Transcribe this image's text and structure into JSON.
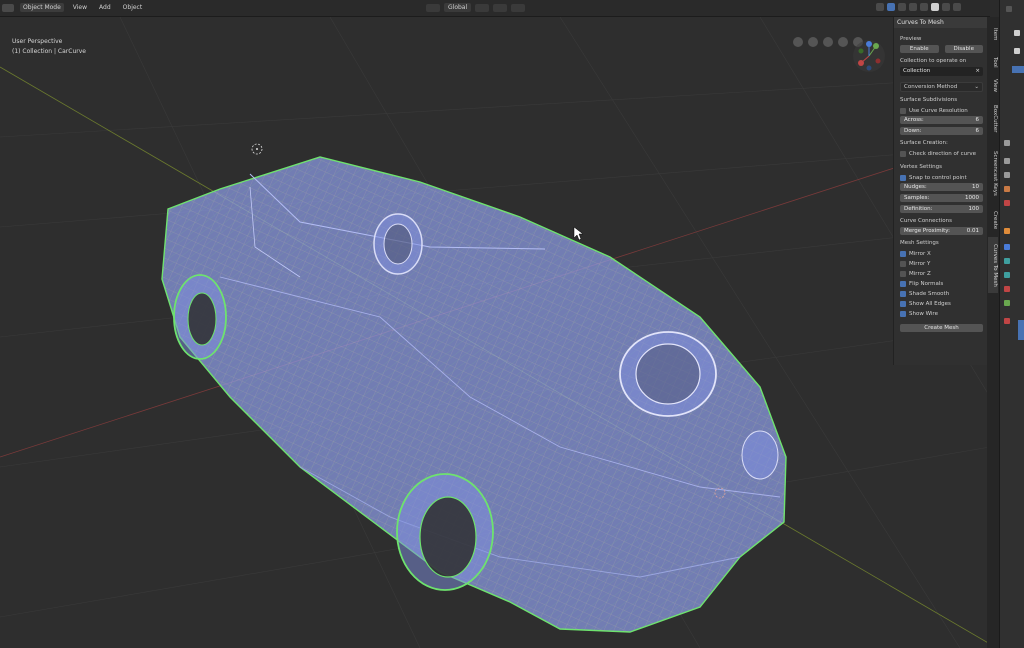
{
  "header": {
    "mode": "Object Mode",
    "menus": [
      "View",
      "Add",
      "Object"
    ],
    "transform_orientation": "Global"
  },
  "viewport": {
    "view_name": "User Perspective",
    "collection_info": "(1) Collection | CarCurve"
  },
  "panel": {
    "title": "Curves To Mesh",
    "preview_label": "Preview",
    "enable_label": "Enable",
    "disable_label": "Disable",
    "collection_label": "Collection to operate on",
    "collection_value": "Collection",
    "conversion_method": "Conversion Method",
    "surface_subdivisions_label": "Surface Subdivisions",
    "use_curve_resolution": "Use Curve Resolution",
    "across_label": "Across:",
    "across_value": "6",
    "down_label": "Down:",
    "down_value": "6",
    "surface_creation_label": "Surface Creation:",
    "check_direction": "Check direction of curve",
    "vertex_settings_label": "Vertex Settings",
    "snap_label": "Snap to control point",
    "nudges_label": "Nudges:",
    "nudges_value": "10",
    "samples_label": "Samples:",
    "samples_value": "1000",
    "definition_label": "Definition:",
    "definition_value": "100",
    "curve_connections_label": "Curve Connections",
    "merge_label": "Merge Proximity:",
    "merge_value": "0.01",
    "mesh_settings_label": "Mesh Settings",
    "mirror_x": "Mirror X",
    "mirror_y": "Mirror Y",
    "mirror_z": "Mirror Z",
    "flip_normals": "Flip Normals",
    "shade_smooth": "Shade Smooth",
    "show_all_edges": "Show All Edges",
    "show_wire": "Show Wire",
    "create_mesh": "Create Mesh"
  },
  "tabs": [
    "Item",
    "Tool",
    "View",
    "BoxCutter",
    "Screencast Keys",
    "Create",
    "Curves To Mesh"
  ],
  "colors": {
    "accent": "#4772b3",
    "mesh_fill": "#8d9ce8",
    "wire_green": "#6ee36e"
  }
}
